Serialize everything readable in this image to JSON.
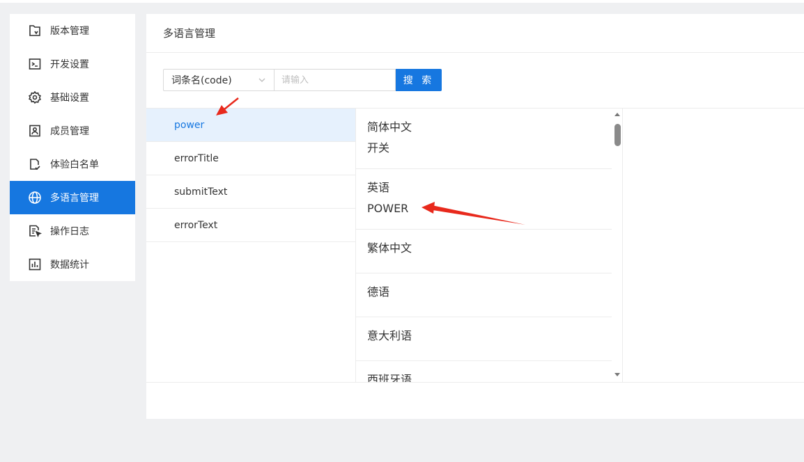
{
  "sidebar": {
    "items": [
      {
        "label": "版本管理",
        "icon": "version-file-icon",
        "active": false
      },
      {
        "label": "开发设置",
        "icon": "terminal-icon",
        "active": false
      },
      {
        "label": "基础设置",
        "icon": "gear-icon",
        "active": false
      },
      {
        "label": "成员管理",
        "icon": "member-badge-icon",
        "active": false
      },
      {
        "label": "体验白名单",
        "icon": "whitelist-check-icon",
        "active": false
      },
      {
        "label": "多语言管理",
        "icon": "globe-icon",
        "active": true
      },
      {
        "label": "操作日志",
        "icon": "log-cursor-icon",
        "active": false
      },
      {
        "label": "数据统计",
        "icon": "bar-chart-icon",
        "active": false
      }
    ]
  },
  "main": {
    "title": "多语言管理",
    "search": {
      "field_select": "词条名(code)",
      "placeholder": "请输入",
      "button_label": "搜 索"
    },
    "keys": [
      "power",
      "errorTitle",
      "submitText",
      "errorText"
    ],
    "selected_key": "power",
    "languages": [
      {
        "name": "简体中文",
        "value": "开关"
      },
      {
        "name": "英语",
        "value": "POWER"
      },
      {
        "name": "繁体中文",
        "value": ""
      },
      {
        "name": "德语",
        "value": ""
      },
      {
        "name": "意大利语",
        "value": ""
      },
      {
        "name": "西班牙语",
        "value": ""
      }
    ]
  },
  "colors": {
    "accent": "#1677e0",
    "selected_bg": "#e6f1fd",
    "annotation_arrow": "#e8291c",
    "page_bg": "#eff0f2"
  }
}
